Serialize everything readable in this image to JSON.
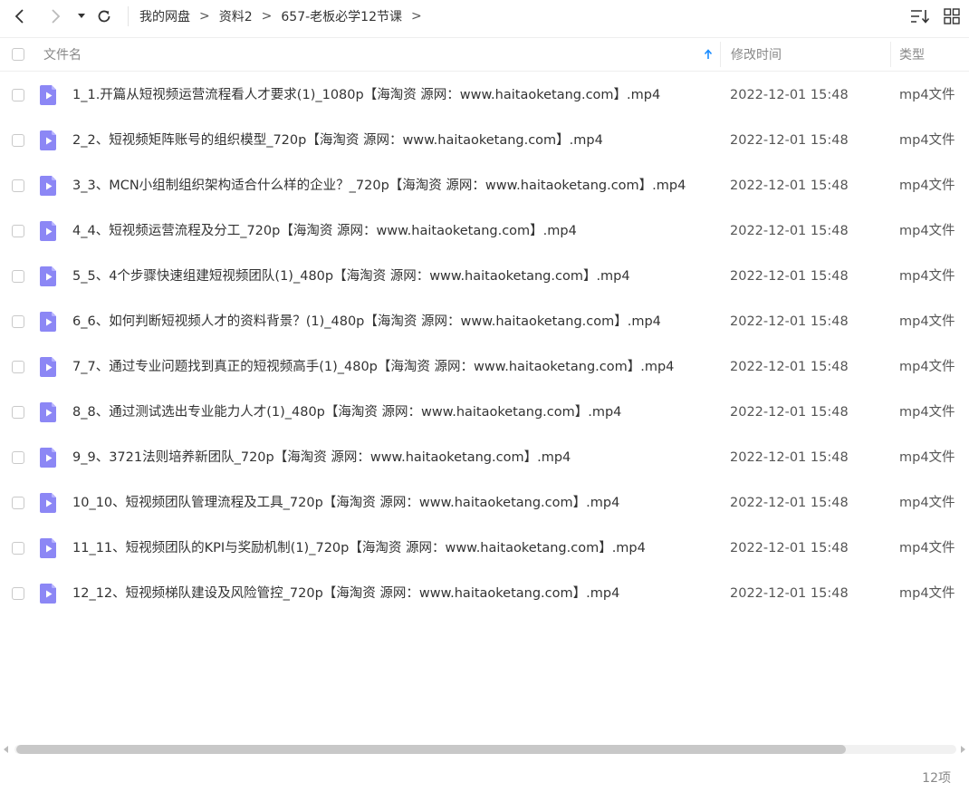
{
  "breadcrumb": [
    "我的网盘",
    "资料2",
    "657-老板必学12节课"
  ],
  "breadcrumb_separator": ">",
  "columns": {
    "name": "文件名",
    "modified": "修改时间",
    "type": "类型"
  },
  "files": [
    {
      "name": "1_1.开篇从短视频运营流程看人才要求(1)_1080p【海淘资 源网：www.haitaoketang.com】.mp4",
      "modified": "2022-12-01 15:48",
      "type": "mp4文件"
    },
    {
      "name": "2_2、短视频矩阵账号的组织模型_720p【海淘资 源网：www.haitaoketang.com】.mp4",
      "modified": "2022-12-01 15:48",
      "type": "mp4文件"
    },
    {
      "name": "3_3、MCN小组制组织架构适合什么样的企业？_720p【海淘资 源网：www.haitaoketang.com】.mp4",
      "modified": "2022-12-01 15:48",
      "type": "mp4文件"
    },
    {
      "name": "4_4、短视频运营流程及分工_720p【海淘资 源网：www.haitaoketang.com】.mp4",
      "modified": "2022-12-01 15:48",
      "type": "mp4文件"
    },
    {
      "name": "5_5、4个步骤快速组建短视频团队(1)_480p【海淘资 源网：www.haitaoketang.com】.mp4",
      "modified": "2022-12-01 15:48",
      "type": "mp4文件"
    },
    {
      "name": "6_6、如何判断短视频人才的资料背景？(1)_480p【海淘资 源网：www.haitaoketang.com】.mp4",
      "modified": "2022-12-01 15:48",
      "type": "mp4文件"
    },
    {
      "name": "7_7、通过专业问题找到真正的短视频高手(1)_480p【海淘资 源网：www.haitaoketang.com】.mp4",
      "modified": "2022-12-01 15:48",
      "type": "mp4文件"
    },
    {
      "name": "8_8、通过测试选出专业能力人才(1)_480p【海淘资 源网：www.haitaoketang.com】.mp4",
      "modified": "2022-12-01 15:48",
      "type": "mp4文件"
    },
    {
      "name": "9_9、3721法则培养新团队_720p【海淘资 源网：www.haitaoketang.com】.mp4",
      "modified": "2022-12-01 15:48",
      "type": "mp4文件"
    },
    {
      "name": "10_10、短视频团队管理流程及工具_720p【海淘资 源网：www.haitaoketang.com】.mp4",
      "modified": "2022-12-01 15:48",
      "type": "mp4文件"
    },
    {
      "name": "11_11、短视频团队的KPI与奖励机制(1)_720p【海淘资 源网：www.haitaoketang.com】.mp4",
      "modified": "2022-12-01 15:48",
      "type": "mp4文件"
    },
    {
      "name": "12_12、短视频梯队建设及风险管控_720p【海淘资 源网：www.haitaoketang.com】.mp4",
      "modified": "2022-12-01 15:48",
      "type": "mp4文件"
    }
  ],
  "footer": {
    "count": "12项"
  },
  "colors": {
    "accent": "#1a8cff",
    "file_icon": "#8c87f5"
  },
  "icons": {
    "back": "chevron-left-icon",
    "forward": "chevron-right-icon",
    "dropdown": "caret-down-icon",
    "refresh": "refresh-icon",
    "sort": "sort-icon",
    "grid": "grid-view-icon",
    "file": "video-file-icon",
    "sort_indicator": "arrow-up-icon"
  }
}
